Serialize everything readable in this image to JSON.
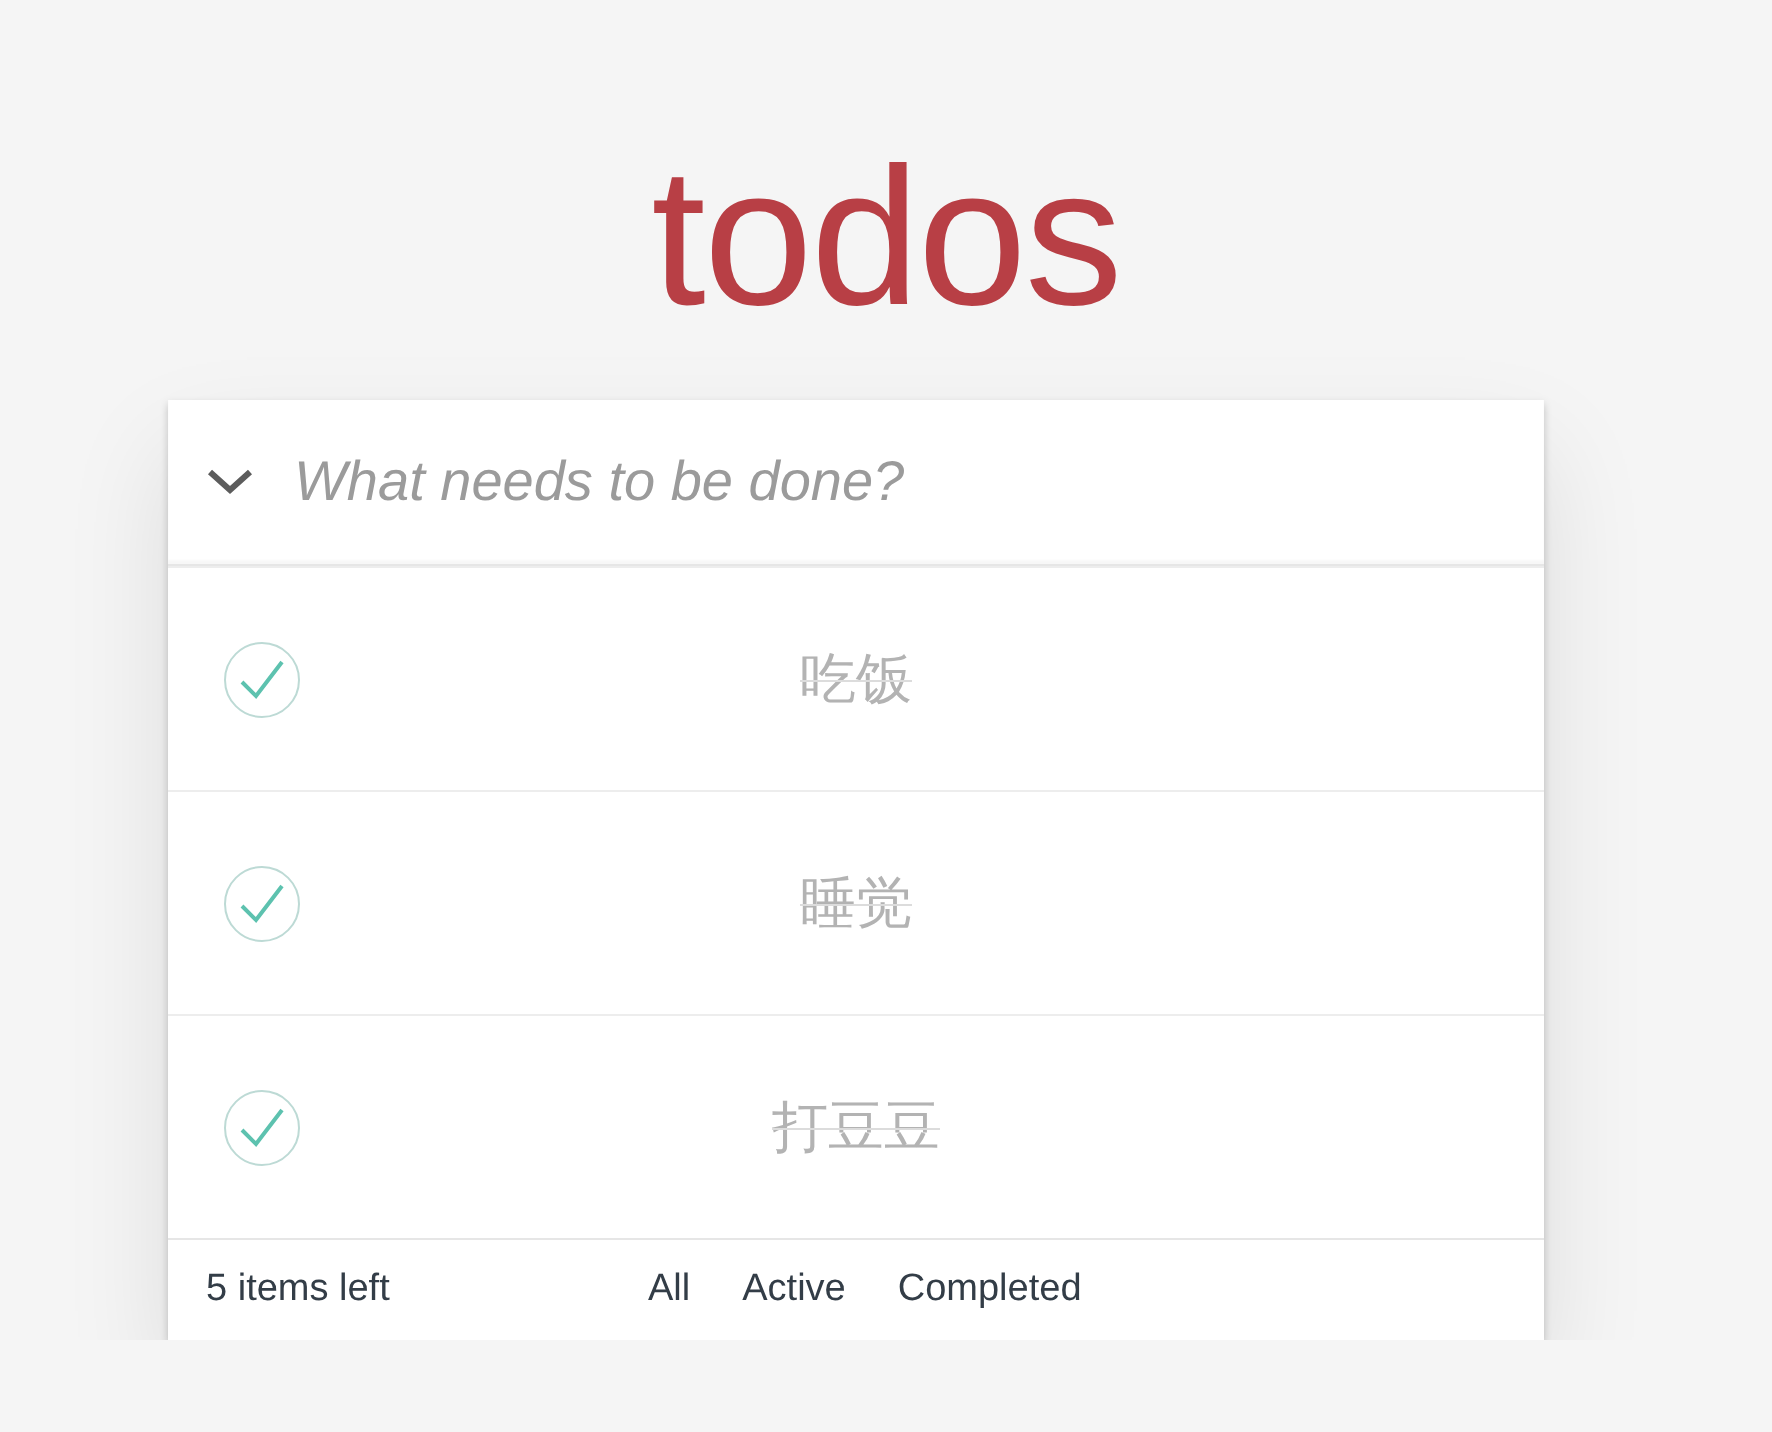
{
  "title": "todos",
  "new_todo": {
    "placeholder": "What needs to be done?"
  },
  "todos": [
    {
      "text": "吃饭",
      "completed": true
    },
    {
      "text": "睡觉",
      "completed": true
    },
    {
      "text": "打豆豆",
      "completed": true
    }
  ],
  "footer": {
    "count": "5 items left",
    "filters": [
      "All",
      "Active",
      "Completed"
    ]
  }
}
